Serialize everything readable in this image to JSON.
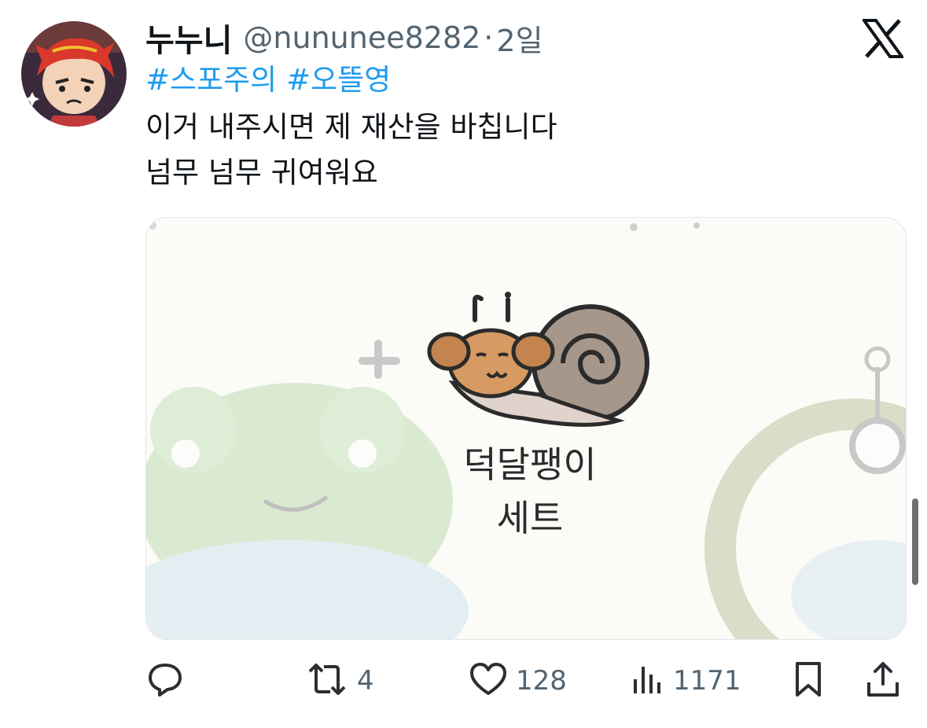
{
  "author": {
    "display_name": "누누니",
    "handle": "@nununee8282",
    "separator": "·",
    "time": "2일"
  },
  "tweet": {
    "hashtags": [
      "#스포주의",
      "#오뜰영"
    ],
    "lines": [
      "이거 내주시면 제 재산을 바칩니다",
      "넘무 넘무 귀여워요"
    ]
  },
  "media": {
    "caption_line1": "덕달팽이",
    "caption_line2": "세트"
  },
  "actions": {
    "reply_count": "",
    "retweet_count": "4",
    "like_count": "128",
    "views_count": "1171"
  },
  "icons": {
    "brand": "x-logo-icon",
    "reply": "reply-icon",
    "retweet": "retweet-icon",
    "like": "heart-icon",
    "views": "views-icon",
    "bookmark": "bookmark-icon",
    "share": "share-icon"
  },
  "colors": {
    "hashtag": "#1d9bf0",
    "secondary_text": "#536471",
    "primary_text": "#0f1419"
  }
}
